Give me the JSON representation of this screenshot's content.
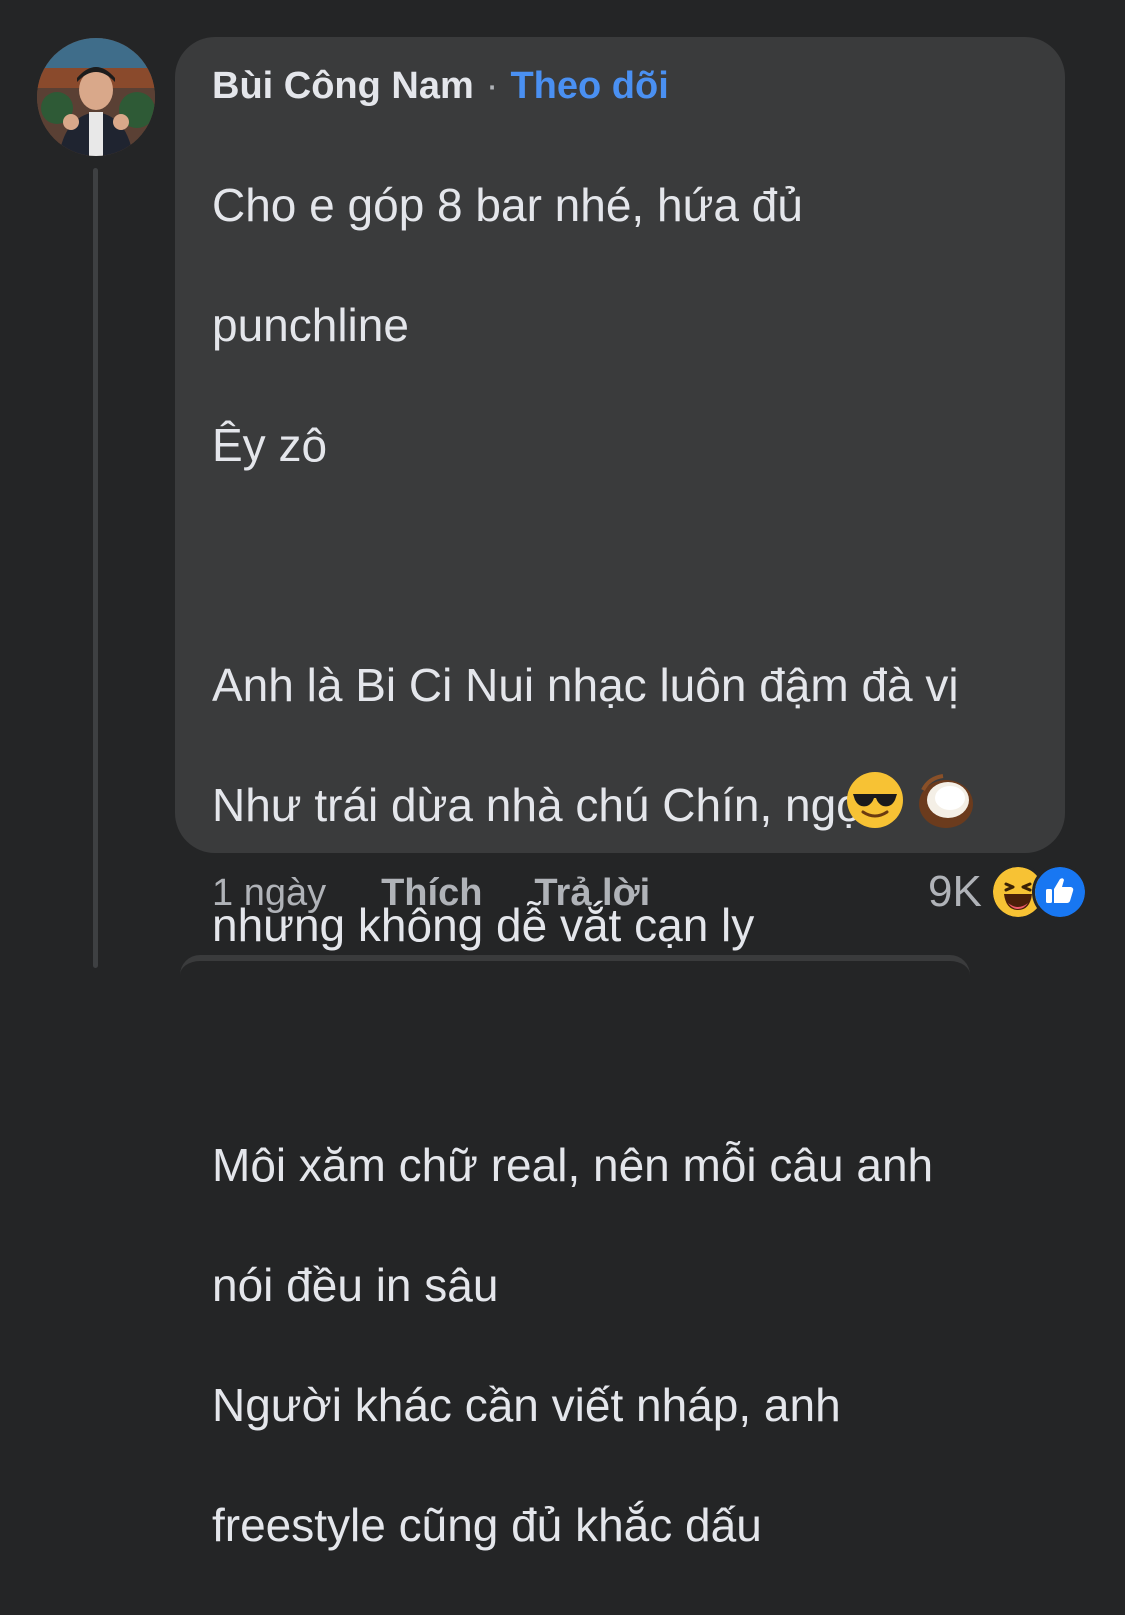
{
  "comment": {
    "author": "Bùi Công Nam",
    "separator": "·",
    "follow_label": "Theo dõi",
    "lines": [
      "Cho e góp 8 bar nhé, hứa đủ",
      "punchline",
      "Êy zô",
      "",
      "Anh là Bi Ci Nui nhạc luôn đậm đà vị",
      "Như trái dừa nhà chú Chín, ngọt",
      "nhưng không dễ vắt cạn ly",
      "",
      "Môi xăm chữ real, nên mỗi câu anh",
      "nói đều in sâu",
      "Người khác cần viết nháp, anh",
      "freestyle cũng đủ khắc dấu"
    ],
    "trailing_emojis": [
      "smiling-face-with-sunglasses-emoji",
      "coconut-emoji"
    ]
  },
  "footer": {
    "time": "1 ngày",
    "like_label": "Thích",
    "reply_label": "Trả lời"
  },
  "reactions": {
    "count": "9K",
    "icons": [
      "haha-reaction-icon",
      "like-reaction-icon"
    ]
  },
  "colors": {
    "background": "#242526",
    "bubble": "#3a3b3c",
    "link_blue": "#4a90f2",
    "secondary_text": "#b0b3b8",
    "primary_text": "#e4e6eb"
  }
}
